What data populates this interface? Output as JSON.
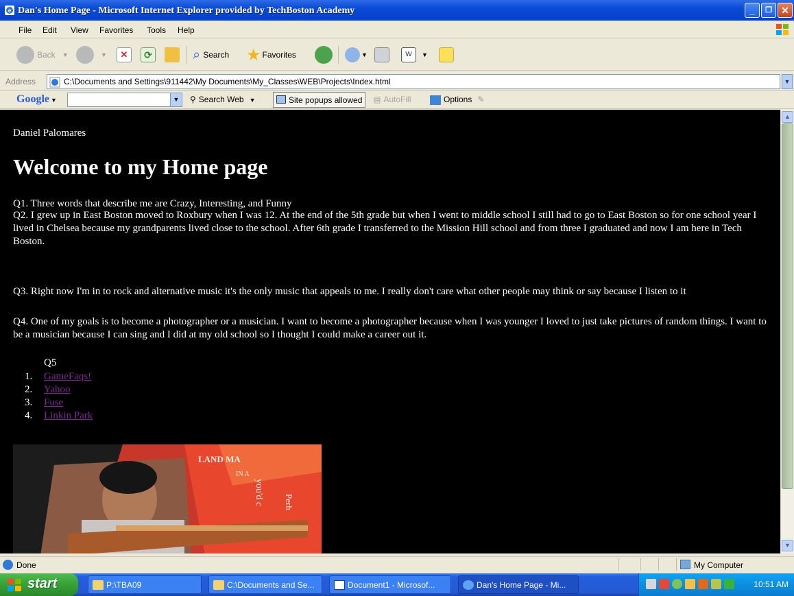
{
  "window": {
    "title": "Dan's Home Page - Microsoft Internet Explorer provided by TechBoston Academy"
  },
  "menu": [
    "File",
    "Edit",
    "View",
    "Favorites",
    "Tools",
    "Help"
  ],
  "toolbar": {
    "back_label": "Back",
    "search_label": "Search",
    "favorites_label": "Favorites"
  },
  "address": {
    "label": "Address",
    "value": "C:\\Documents and Settings\\911442\\My Documents\\My_Classes\\WEB\\Projects\\Index.html"
  },
  "google_bar": {
    "logo": "Google",
    "search_web_label": "Search Web",
    "popups_label": "Site popups allowed",
    "autofill_label": "AutoFill",
    "options_label": "Options"
  },
  "page": {
    "author": "Daniel Palomares",
    "heading": "Welcome to my Home page",
    "q1": "Q1. Three words that describe me are Crazy, Interesting, and Funny",
    "q2": "Q2. I grew up in East Boston moved to Roxbury when I was 12. At the end of the 5th grade but when I went to middle school I still had to go to East Boston so for one school year I lived in Chelsea because my grandparents lived close to the school. After 6th grade I transferred to the Mission Hill school and from three I graduated and now I am here in Tech Boston.",
    "q3": "Q3. Right now I'm in to rock and alternative music it's the only music that appeals to me. I really don't care what other people may think or say because I listen to it",
    "q4": "Q4. One of my goals is to become a photographer or a musician. I want to become a photographer because when I was younger I loved to just take pictures of random things. I want to be a musician because I can sing and I did at my old school so I thought I could make a career out it.",
    "q5_heading": "Q5",
    "links": [
      {
        "num": "1.",
        "label": "GameFaqs!"
      },
      {
        "num": "2.",
        "label": "Yahoo"
      },
      {
        "num": "3.",
        "label": "Fuse"
      },
      {
        "num": "4.",
        "label": "Linkin Park"
      }
    ],
    "photo_text": [
      "LAND MA",
      "IN A",
      "you'd c",
      "Perh"
    ]
  },
  "status": {
    "text": "Done",
    "zone": "My Computer"
  },
  "taskbar": {
    "start_label": "start",
    "tasks": [
      {
        "label": "P:\\TBA09"
      },
      {
        "label": "C:\\Documents and Se..."
      },
      {
        "label": "Document1 - Microsof..."
      },
      {
        "label": "Dan's Home Page - Mi..."
      }
    ],
    "clock": "10:51 AM"
  },
  "colors": {
    "titlebar": "#0a4bd6",
    "page_background": "#000000",
    "visited_link": "#7b2b8f",
    "start_button": "#37a037"
  }
}
